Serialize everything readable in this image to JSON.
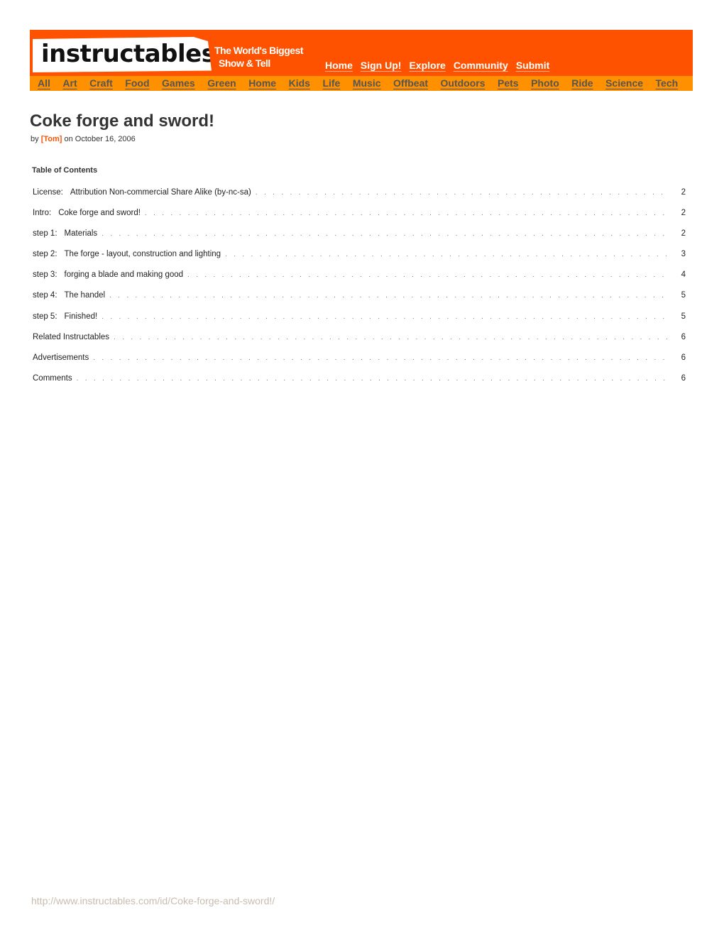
{
  "header": {
    "logo": "instructables",
    "tagline_line1": "The World's Biggest",
    "tagline_line2": "Show & Tell",
    "brand_color": "#ff5200",
    "category_bar_color": "#ff9000",
    "top_nav": [
      "Home",
      "Sign Up!",
      "Explore",
      "Community",
      "Submit"
    ],
    "categories": [
      "All",
      "Art",
      "Craft",
      "Food",
      "Games",
      "Green",
      "Home",
      "Kids",
      "Life",
      "Music",
      "Offbeat",
      "Outdoors",
      "Pets",
      "Photo",
      "Ride",
      "Science",
      "Tech"
    ]
  },
  "article": {
    "title": "Coke forge and sword!",
    "by_label": "by",
    "author": "[Tom]",
    "date_text": "on October 16, 2006"
  },
  "toc": {
    "heading": "Table of Contents",
    "entries": [
      {
        "prefix": "License:",
        "label": "Attribution Non-commercial Share Alike (by-nc-sa)",
        "page": "2"
      },
      {
        "prefix": "Intro:",
        "label": "Coke forge and sword!",
        "page": "2"
      },
      {
        "prefix": "step 1:",
        "label": "Materials",
        "page": "2"
      },
      {
        "prefix": "step 2:",
        "label": "The forge - layout, construction and lighting",
        "page": "3"
      },
      {
        "prefix": "step 3:",
        "label": "forging a blade and making good",
        "page": "4"
      },
      {
        "prefix": "step 4:",
        "label": "The handel",
        "page": "5"
      },
      {
        "prefix": "step 5:",
        "label": "Finished!",
        "page": "5"
      },
      {
        "prefix": "",
        "label": "Related Instructables",
        "page": "6"
      },
      {
        "prefix": "",
        "label": "Advertisements",
        "page": "6"
      },
      {
        "prefix": "",
        "label": "Comments",
        "page": "6"
      }
    ]
  },
  "footer": {
    "url": "http://www.instructables.com/id/Coke-forge-and-sword!/"
  }
}
